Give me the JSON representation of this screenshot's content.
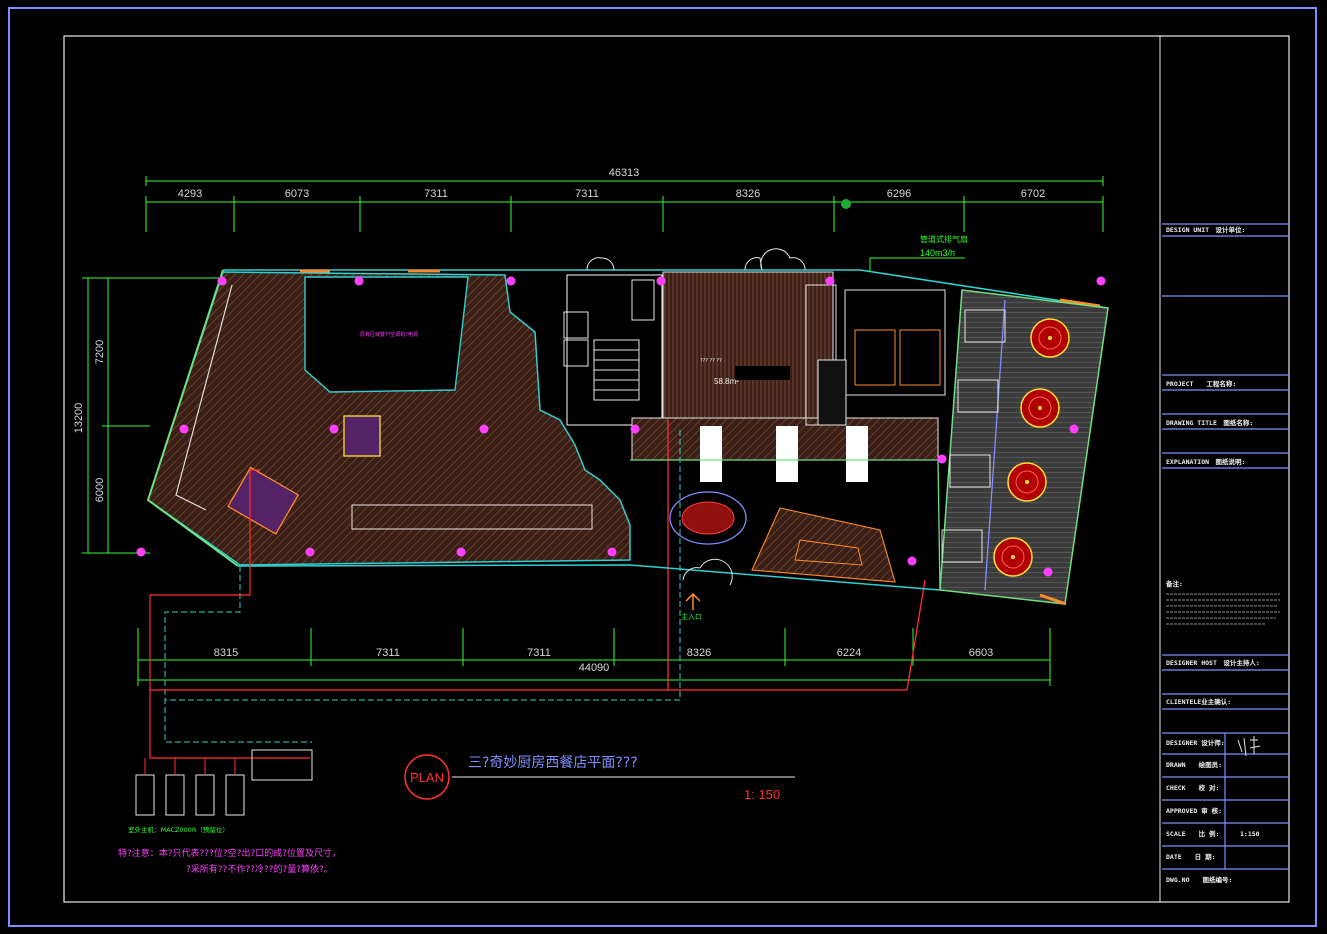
{
  "drawing": {
    "title": "三?奇妙厨房西餐店平面???",
    "scale": "1: 150",
    "plan_badge": "PLAN"
  },
  "dimensions": {
    "top_total": "46313",
    "top_segments": [
      "4293",
      "6073",
      "7311",
      "7311",
      "8326",
      "6296",
      "6702"
    ],
    "bottom_total": "44090",
    "bottom_segments": [
      "8315",
      "7311",
      "7311",
      "8326",
      "6224",
      "6603"
    ],
    "left_total": "13200",
    "left_segments": [
      "7200",
      "6000"
    ]
  },
  "annotations": {
    "exhaust_label": "管道式排气扇",
    "exhaust_rate": "140m3/h",
    "area_value": "58.8m²",
    "entrance": "主入口",
    "equipment_caption": "室外主机：MACZ000R（预留位）",
    "note_line1": "特?注意：本?只代表???位?空?出?口的成?位置及尺寸，",
    "note_line2": "?采所有??不作??冷??的?量?算依?。"
  },
  "title_block": {
    "design_unit": "DESIGN UNIT　设计单位:",
    "project": "PROJECT　　工程名称:",
    "drawing_title": "DRAWING TITLE　图纸名称:",
    "explanation": "EXPLANATION　图纸说明:",
    "notes_heading": "备注:",
    "designer_host": "DESIGNER HOST　设计主持人:",
    "client": "CLIENTELE业主确认:",
    "designer": "DESIGNER 设计师:",
    "drawn": "DRAWN　　绘图员:",
    "check": "CHECK　　校 对:",
    "approved": "APPROVED 审 核:",
    "scale_label": "SCALE　　比 例:",
    "scale_value": "1:150",
    "date": "DATE　　日 期:",
    "dwg_no": "DWG.NO　　图纸编号:"
  }
}
